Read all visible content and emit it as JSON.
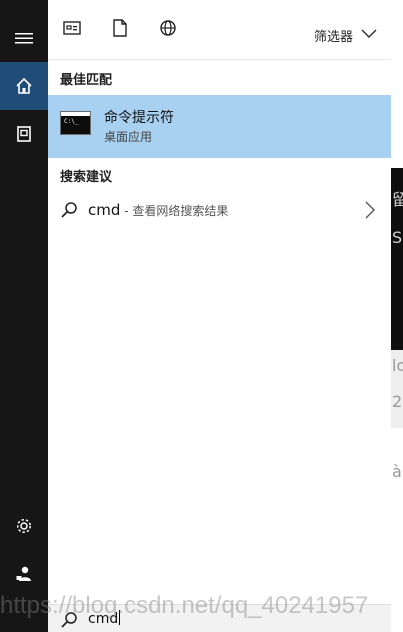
{
  "topbar": {
    "icons": [
      "apps-icon",
      "document-icon",
      "web-icon"
    ],
    "filter_label": "筛选器"
  },
  "left_rail": {
    "top_items": [
      "menu-icon",
      "home-icon",
      "notebook-icon"
    ],
    "bottom_items": [
      "settings-icon",
      "user-feedback-icon"
    ]
  },
  "best_match": {
    "heading": "最佳匹配",
    "title": "命令提示符",
    "subtitle": "桌面应用",
    "thumb_prompt": "C:\\_"
  },
  "suggestions": {
    "heading": "搜索建议",
    "items": [
      {
        "query": "cmd",
        "separator": " - ",
        "description": "查看网络搜索结果"
      }
    ]
  },
  "search": {
    "value": "cmd"
  },
  "background_fragments": [
    "留",
    "Se",
    "lo",
    "23",
    "à"
  ],
  "watermark": "https://blog.csdn.net/qq_40241957",
  "colors": {
    "rail": "#161616",
    "rail_active": "#1f4d78",
    "selection": "#a8d1f1"
  }
}
